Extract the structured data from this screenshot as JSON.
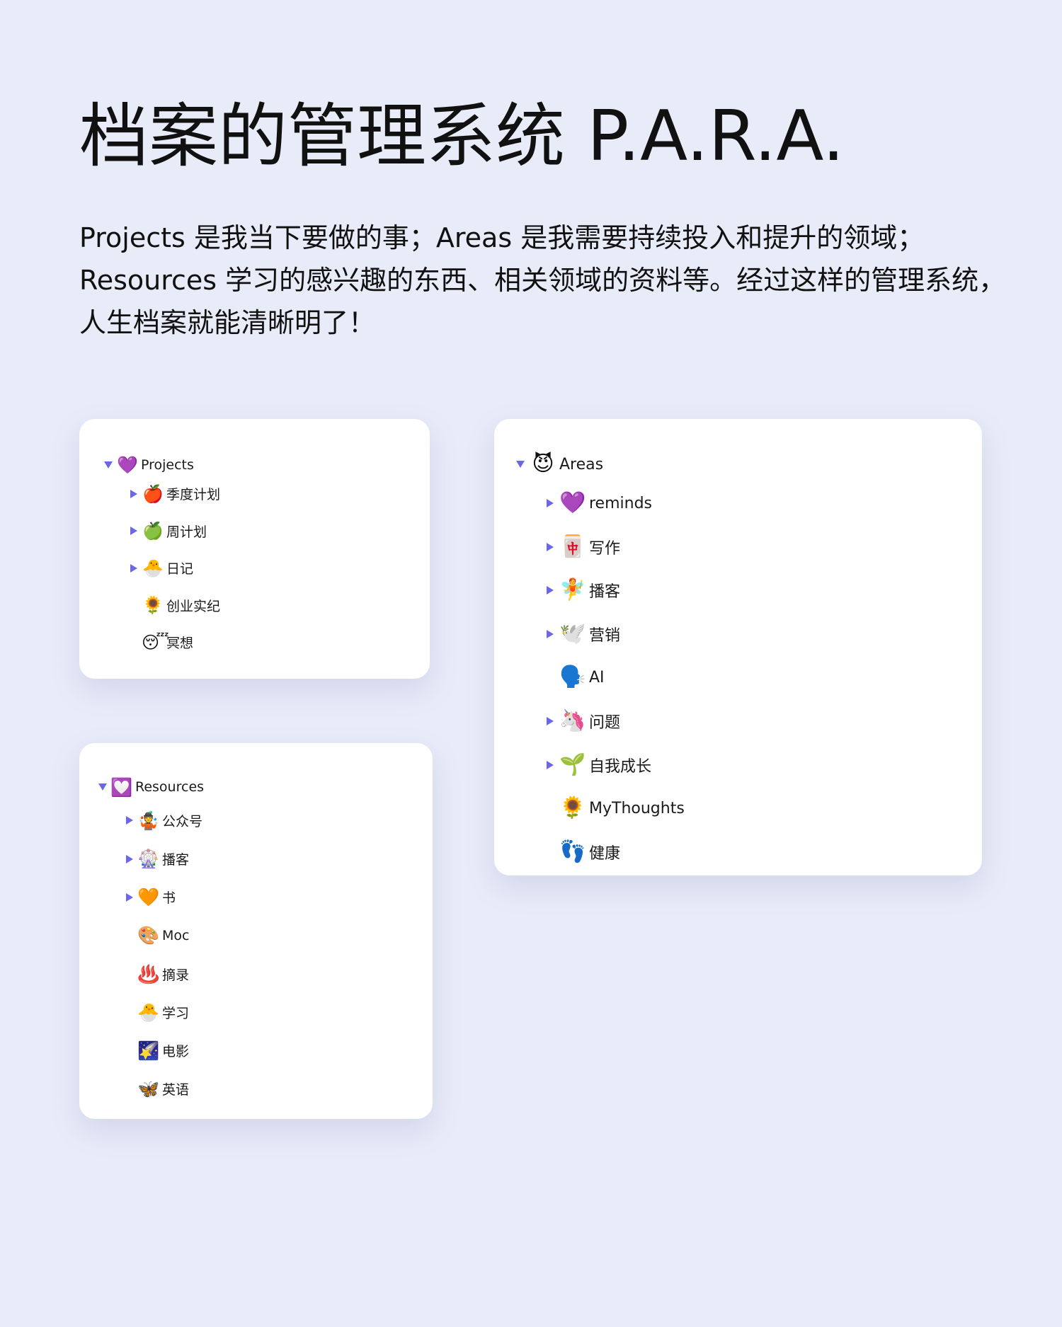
{
  "header": {
    "title": "档案的管理系统 P.A.R.A.",
    "intro_lines": [
      "Projects 是我当下要做的事；Areas 是我需要持续投入和提升的领域；",
      "Resources 学习的感兴趣的东西、相关领域的资料等。经过这样的管理系统，",
      "人生档案就能清晰明了！"
    ]
  },
  "projects": {
    "root": {
      "icon": "💜",
      "icon_name": "purple-heart-icon",
      "label": "Projects",
      "expanded": true
    },
    "items": [
      {
        "icon": "🍎",
        "icon_name": "red-apple-icon",
        "label": "季度计划",
        "has_children": true
      },
      {
        "icon": "🍏",
        "icon_name": "green-apple-icon",
        "label": "周计划",
        "has_children": true
      },
      {
        "icon": "🐣",
        "icon_name": "hatching-chick-icon",
        "label": "日记",
        "has_children": true
      },
      {
        "icon": "🌻",
        "icon_name": "sunflower-icon",
        "label": "创业实纪",
        "has_children": false
      },
      {
        "icon": "😴",
        "icon_name": "sleeping-face-icon",
        "label": "冥想",
        "has_children": false
      }
    ]
  },
  "areas": {
    "root": {
      "icon": "😈",
      "icon_name": "smiling-devil-icon",
      "label": "Areas",
      "expanded": true
    },
    "items": [
      {
        "icon": "💜",
        "icon_name": "purple-heart-icon",
        "label": "reminds",
        "has_children": true
      },
      {
        "icon": "🀄",
        "icon_name": "mahjong-tile-icon",
        "label": "写作",
        "has_children": true
      },
      {
        "icon": "🧚",
        "icon_name": "fairy-icon",
        "label": "播客",
        "has_children": true
      },
      {
        "icon": "🕊️",
        "icon_name": "dove-icon",
        "label": "营销",
        "has_children": true
      },
      {
        "icon": "🗣️",
        "icon_name": "speaking-head-icon",
        "label": "AI",
        "has_children": false
      },
      {
        "icon": "🦄",
        "icon_name": "unicorn-icon",
        "label": "问题",
        "has_children": true
      },
      {
        "icon": "🌱",
        "icon_name": "seedling-icon",
        "label": "自我成长",
        "has_children": true
      },
      {
        "icon": "🌻",
        "icon_name": "sunflower-icon",
        "label": "MyThoughts",
        "has_children": false
      },
      {
        "icon": "👣",
        "icon_name": "footprints-icon",
        "label": "健康",
        "has_children": false
      }
    ]
  },
  "resources": {
    "root": {
      "icon": "💟",
      "icon_name": "heart-decoration-icon",
      "label": "Resources",
      "expanded": true
    },
    "items": [
      {
        "icon": "🤹",
        "icon_name": "juggling-person-icon",
        "label": "公众号",
        "has_children": true
      },
      {
        "icon": "🎡",
        "icon_name": "ferris-wheel-icon",
        "label": "播客",
        "has_children": true
      },
      {
        "icon": "🧡",
        "icon_name": "orange-heart-icon",
        "label": "书",
        "has_children": true
      },
      {
        "icon": "🎨",
        "icon_name": "artist-palette-icon",
        "label": "Moc",
        "has_children": false
      },
      {
        "icon": "♨️",
        "icon_name": "hot-springs-icon",
        "label": "摘录",
        "has_children": false
      },
      {
        "icon": "🐣",
        "icon_name": "hatching-chick-icon",
        "label": "学习",
        "has_children": false
      },
      {
        "icon": "🌠",
        "icon_name": "shooting-star-icon",
        "label": "电影",
        "has_children": false
      },
      {
        "icon": "🦋",
        "icon_name": "butterfly-icon",
        "label": "英语",
        "has_children": false
      }
    ]
  },
  "colors": {
    "background": "#e8ebf8",
    "card": "#ffffff",
    "caret": "#6b67e6",
    "text": "#111111"
  }
}
